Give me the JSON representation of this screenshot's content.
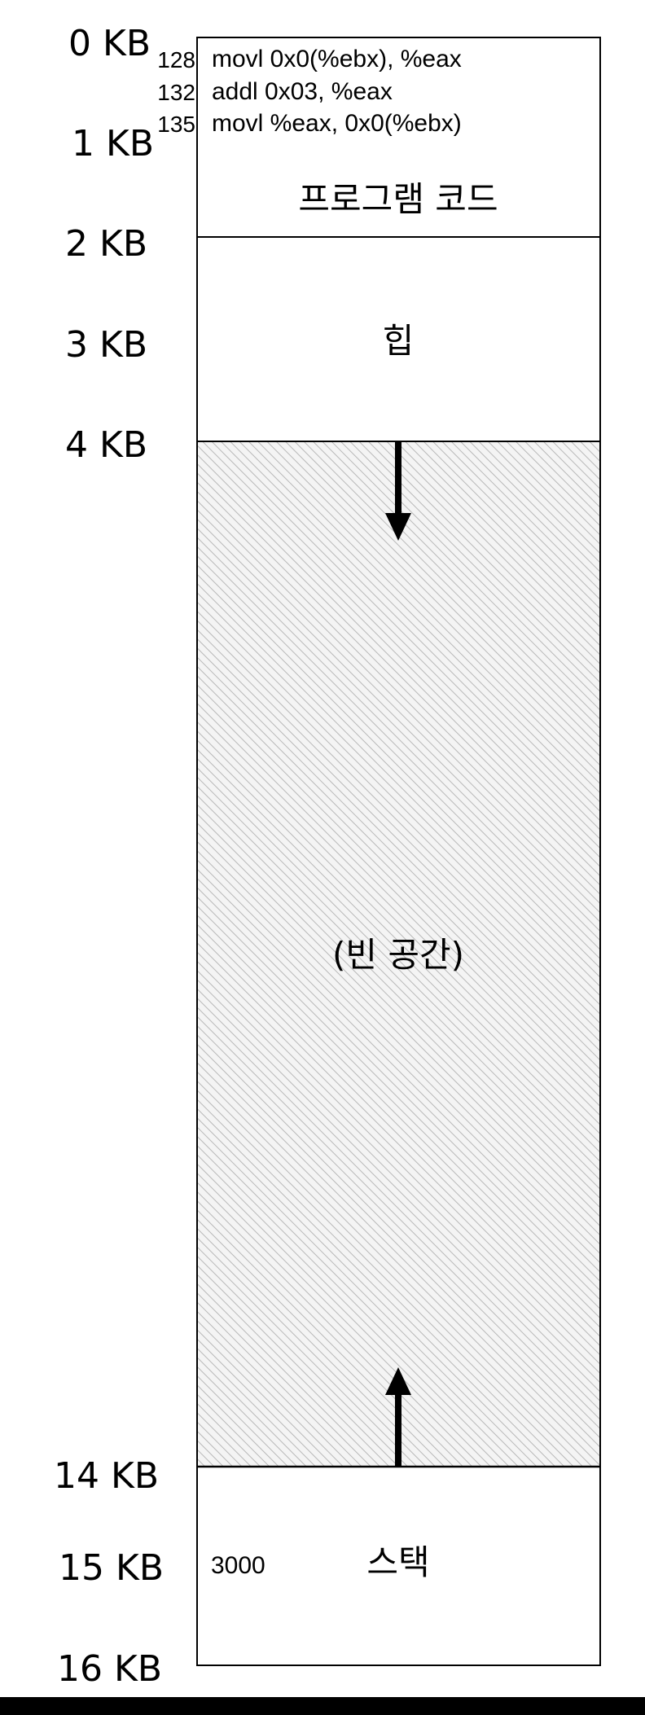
{
  "address_labels": [
    "0 KB",
    "1 KB",
    "2 KB",
    "3 KB",
    "4 KB",
    "14 KB",
    "15 KB",
    "16 KB"
  ],
  "code": {
    "label": "프로그램 코드",
    "instructions": [
      {
        "address": "128",
        "text": "movl 0x0(%ebx), %eax"
      },
      {
        "address": "132",
        "text": "addl 0x03, %eax"
      },
      {
        "address": "135",
        "text": "movl %eax, 0x0(%ebx)"
      }
    ]
  },
  "heap": {
    "label": "힙"
  },
  "free": {
    "label": "(빈 공간)"
  },
  "stack": {
    "label": "스택",
    "value": "3000"
  },
  "colors": {
    "border": "#000000",
    "hatch": "#b8b8b8",
    "free_background": "#f4f4f4"
  }
}
